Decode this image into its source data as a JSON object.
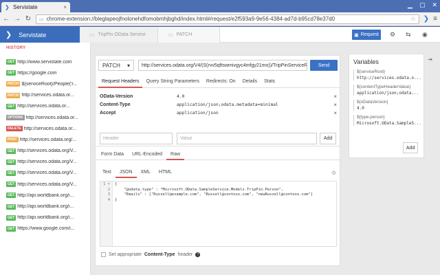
{
  "browser": {
    "tab_title": "Servistate",
    "tab_close": "×",
    "url": "chrome-extension://bleglapeojfnolonehdfomobmhjbghd/index.html#/request/e2f593a9-9e56-4384-ad7d-b95cd78e37d0"
  },
  "app": {
    "name": "Servistate",
    "accent": "#3a6ebd",
    "breadcrumbs": [
      "TripPin OData Service",
      "PATCH"
    ],
    "request_button": "Request"
  },
  "history": {
    "label": "HISTORY",
    "items": [
      {
        "method": "GET",
        "url": "http://www.servistate.com"
      },
      {
        "method": "GET",
        "url": "https://google.com"
      },
      {
        "method": "PATCH",
        "url": "${serviceRoot}/People('r..."
      },
      {
        "method": "PATCH",
        "url": "http://services.odata.or..."
      },
      {
        "method": "GET",
        "url": "http://services.odata.or..."
      },
      {
        "method": "OPTIONS",
        "url": "http://services.odata.or..."
      },
      {
        "method": "DELETE",
        "url": "http://services.odata.or..."
      },
      {
        "method": "POST",
        "url": "http://services.odata.org/..."
      },
      {
        "method": "GET",
        "url": "http://services.odata.org/V..."
      },
      {
        "method": "GET",
        "url": "http://services.odata.org/V..."
      },
      {
        "method": "GET",
        "url": "http://services.odata.org/V..."
      },
      {
        "method": "GET",
        "url": "http://services.odata.org/V..."
      },
      {
        "method": "GET",
        "url": "http://api.worldbank.org/i..."
      },
      {
        "method": "GET",
        "url": "http://api.worldbank.org/i..."
      },
      {
        "method": "GET",
        "url": "http://api.worldbank.org/i..."
      },
      {
        "method": "GET",
        "url": "https://www.google.com/i..."
      }
    ]
  },
  "request": {
    "method": "PATCH",
    "url": "http://services.odata.org/V4/(S(rvv5qftswmivgyc4mfgy21mo))/TripPinServiceRW",
    "send_label": "Send",
    "tabs": [
      "Request Headers",
      "Query String Parameters",
      "Redirects: On",
      "Details",
      "Stats"
    ],
    "active_tab": 0,
    "headers": [
      {
        "name": "OData-Version",
        "value": "4.0"
      },
      {
        "name": "Content-Type",
        "value": "application/json;odata.metadata=minimal"
      },
      {
        "name": "Accept",
        "value": "application/json"
      }
    ],
    "header_placeholder": "Header",
    "value_placeholder": "Value",
    "add_label": "Add"
  },
  "body": {
    "tabs": [
      "Form Data",
      "URL-Encoded",
      "Raw"
    ],
    "active_tab": 2,
    "formats": [
      "Text",
      "JSON",
      "XML",
      "HTML"
    ],
    "active_format": 1,
    "lines": [
      "{",
      "    \"@odata.type\" : \"Microsoft.OData.SampleService.Models.TripPin.Person\",",
      "    \"Emails\" : [\"Russell@example.com\", \"Russell@contoso.com\", \"newRussell@contoso.com\"]",
      "}"
    ],
    "line_numbers": [
      "1 ▾",
      "2",
      "3",
      "4"
    ],
    "ct_label_prefix": "Set appropriate",
    "ct_label_bold": "Content-Type",
    "ct_label_suffix": "header"
  },
  "variables": {
    "title": "Variables",
    "items": [
      {
        "name": "${serviceRoot}",
        "value": "http://services.odata.o..."
      },
      {
        "name": "${contentTypeHeaderValue}",
        "value": "application/json;odata..."
      },
      {
        "name": "${oDataVersion}",
        "value": "4.0"
      },
      {
        "name": "${type.person}",
        "value": "Microsoft.OData.SampleS..."
      }
    ],
    "add_label": "Add"
  }
}
